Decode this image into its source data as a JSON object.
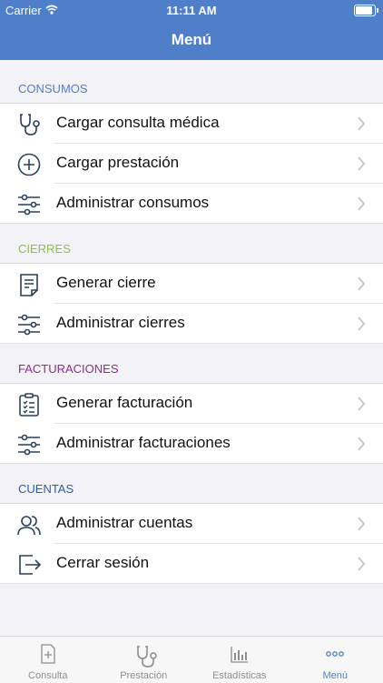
{
  "status_bar": {
    "carrier": "Carrier",
    "time": "11:11 AM"
  },
  "nav": {
    "title": "Menú"
  },
  "sections": [
    {
      "header": "CONSUMOS",
      "color": "#4f7fc9",
      "items": [
        {
          "label": "Cargar consulta médica",
          "icon": "stethoscope-icon"
        },
        {
          "label": "Cargar prestación",
          "icon": "plus-circle-icon"
        },
        {
          "label": "Administrar consumos",
          "icon": "sliders-icon"
        }
      ]
    },
    {
      "header": "CIERRES",
      "color": "#8bc34a",
      "items": [
        {
          "label": "Generar cierre",
          "icon": "document-icon"
        },
        {
          "label": "Administrar cierres",
          "icon": "sliders-icon"
        }
      ]
    },
    {
      "header": "FACTURACIONES",
      "color": "#8e2d8e",
      "items": [
        {
          "label": "Generar facturación",
          "icon": "checklist-icon"
        },
        {
          "label": "Administrar facturaciones",
          "icon": "sliders-icon"
        }
      ]
    },
    {
      "header": "CUENTAS",
      "color": "#2a5fa8",
      "items": [
        {
          "label": "Administrar cuentas",
          "icon": "users-icon"
        },
        {
          "label": "Cerrar sesión",
          "icon": "logout-icon"
        }
      ]
    }
  ],
  "tabs": [
    {
      "label": "Consulta",
      "icon": "document-plus-icon",
      "active": false
    },
    {
      "label": "Prestación",
      "icon": "stethoscope-icon",
      "active": false
    },
    {
      "label": "Estadísticas",
      "icon": "bar-chart-icon",
      "active": false
    },
    {
      "label": "Menú",
      "icon": "more-icon",
      "active": true
    }
  ],
  "colors": {
    "nav": "#4f7fc9",
    "icon_stroke": "#2b3f5c",
    "chevron": "#c7c7cc"
  }
}
